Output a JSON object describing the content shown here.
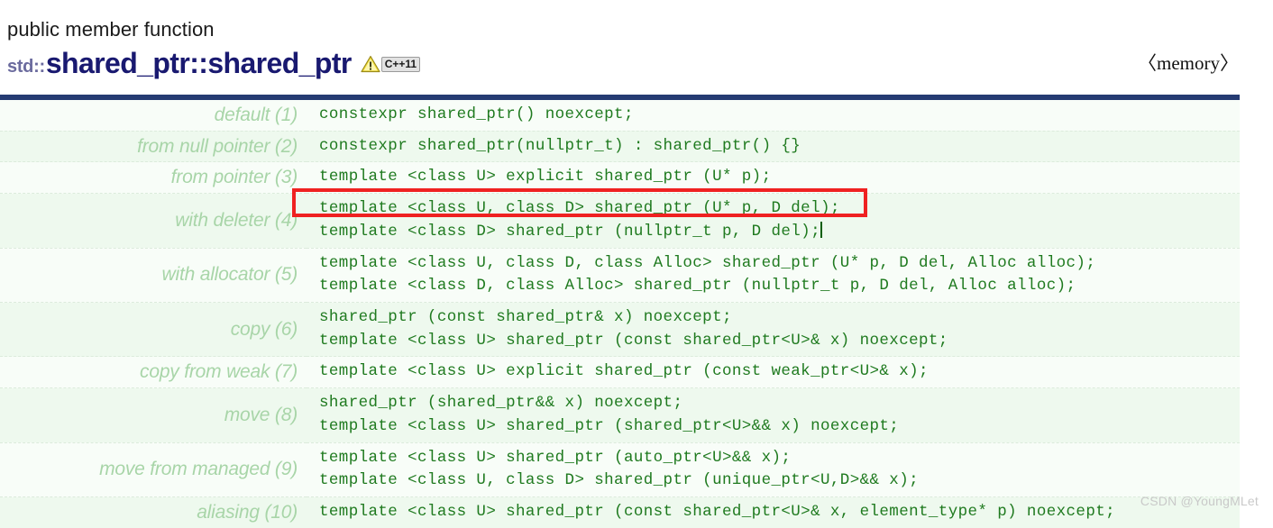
{
  "header": {
    "kind": "public member function",
    "namespace_prefix": "std::",
    "function_name": "shared_ptr::shared_ptr",
    "warning_icon": "warning-triangle-icon",
    "standard_badge": "C++11",
    "header_file": "〈memory〉"
  },
  "signatures": {
    "rows": [
      {
        "label": "default (1)",
        "lines": [
          "constexpr shared_ptr() noexcept;"
        ]
      },
      {
        "label": "from null pointer (2)",
        "lines": [
          "constexpr shared_ptr(nullptr_t) : shared_ptr() {}"
        ]
      },
      {
        "label": "from pointer (3)",
        "lines": [
          "template <class U> explicit shared_ptr (U* p);"
        ]
      },
      {
        "label": "with deleter (4)",
        "lines": [
          "template <class U, class D> shared_ptr (U* p, D del);",
          "template <class D> shared_ptr (nullptr_t p, D del);"
        ],
        "caret_after_last_line": true
      },
      {
        "label": "with allocator (5)",
        "lines": [
          "template <class U, class D, class Alloc> shared_ptr (U* p, D del, Alloc alloc);",
          "template <class D, class Alloc> shared_ptr (nullptr_t p, D del, Alloc alloc);"
        ]
      },
      {
        "label": "copy (6)",
        "lines": [
          "shared_ptr (const shared_ptr& x) noexcept;",
          "template <class U> shared_ptr (const shared_ptr<U>& x) noexcept;"
        ]
      },
      {
        "label": "copy from weak (7)",
        "lines": [
          "template <class U> explicit shared_ptr (const weak_ptr<U>& x);"
        ]
      },
      {
        "label": "move (8)",
        "lines": [
          "shared_ptr (shared_ptr&& x) noexcept;",
          "template <class U> shared_ptr (shared_ptr<U>&& x) noexcept;"
        ]
      },
      {
        "label": "move from managed (9)",
        "lines": [
          "template <class U> shared_ptr (auto_ptr<U>&& x);",
          "template <class U, class D> shared_ptr (unique_ptr<U,D>&& x);"
        ]
      },
      {
        "label": "aliasing (10)",
        "lines": [
          "template <class U> shared_ptr (const shared_ptr<U>& x, element_type* p) noexcept;"
        ]
      }
    ]
  },
  "annotation": {
    "highlight_box_color": "#ef2121",
    "highlighted_signature": "template <class U, class D> shared_ptr (U* p, D del);"
  },
  "watermark": "CSDN @YoungMLet",
  "colors": {
    "table_top_bar": "#253b72",
    "code_text": "#1f7a1f",
    "label_text": "#a8d5a8",
    "title_text": "#191970",
    "namespace_text": "#6b6b9e",
    "row_odd_bg": "#f8fdf8",
    "row_even_bg": "#eef9ee"
  }
}
